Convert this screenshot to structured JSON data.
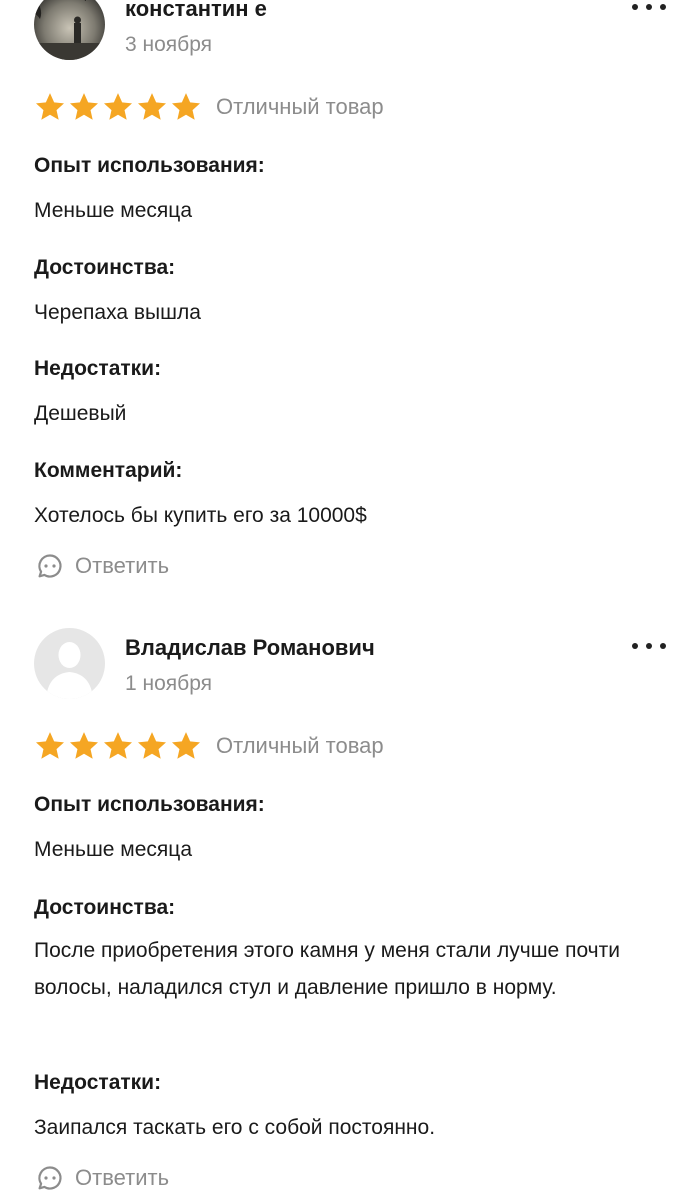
{
  "reviews": [
    {
      "author": "константин е",
      "date": "3 ноября",
      "rating": 5,
      "rating_text": "Отличный товар",
      "sections": [
        {
          "title": "Опыт использования:",
          "text": "Меньше месяца"
        },
        {
          "title": "Достоинства:",
          "text": "Черепаха вышла"
        },
        {
          "title": "Недостатки:",
          "text": "Дешевый"
        },
        {
          "title": "Комментарий:",
          "text": "Хотелось бы купить его за 10000$"
        }
      ],
      "reply_label": "Ответить",
      "avatar_icon": "photo-avatar"
    },
    {
      "author": "Владислав Романович",
      "date": "1 ноября",
      "rating": 5,
      "rating_text": "Отличный товар",
      "sections": [
        {
          "title": "Опыт использования:",
          "text": "Меньше месяца"
        },
        {
          "title": "Достоинства:",
          "text": "После приобретения этого камня у меня стали лучше почти волосы, наладился стул и давление пришло в норму."
        },
        {
          "title": "Недостатки:",
          "text": "Заипался таскать его с собой постоянно."
        }
      ],
      "reply_label": "Ответить",
      "avatar_icon": "default-user-avatar"
    }
  ],
  "colors": {
    "star": "#F5A623",
    "muted_text": "#8C8C8C",
    "text": "#1A1A1A"
  }
}
